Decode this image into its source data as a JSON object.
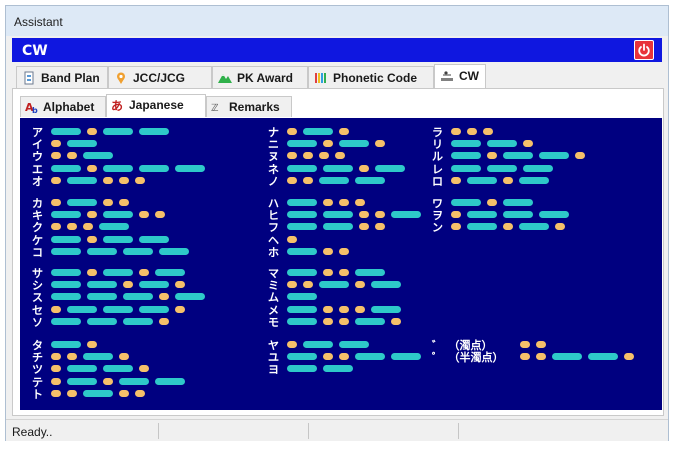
{
  "window": {
    "title": "Assistant"
  },
  "header": {
    "title": "CW"
  },
  "main_tabs": [
    {
      "label": "Band Plan",
      "icon": "document-icon"
    },
    {
      "label": "JCC/JCG",
      "icon": "map-pin-icon"
    },
    {
      "label": "PK Award",
      "icon": "mountain-icon"
    },
    {
      "label": "Phonetic Code",
      "icon": "bars-icon"
    },
    {
      "label": "CW",
      "icon": "key-icon",
      "active": true
    }
  ],
  "sub_tabs": [
    {
      "label": "Alphabet",
      "icon": "alphabet-icon"
    },
    {
      "label": "Japanese",
      "icon": "japanese-icon",
      "active": true
    },
    {
      "label": "Remarks",
      "icon": "remarks-icon"
    }
  ],
  "morse": {
    "colors": {
      "dit": "#f5c06a",
      "dah": "#2ec9c9",
      "background": "#000080"
    },
    "columns": [
      {
        "groups": [
          [
            [
              "ア",
              "-.--"
            ],
            [
              "イ",
              ".-"
            ],
            [
              "ウ",
              "..-"
            ],
            [
              "エ",
              "-.---"
            ],
            [
              "オ",
              ".-..."
            ]
          ],
          [
            [
              "カ",
              ".-.."
            ],
            [
              "キ",
              "-.-.."
            ],
            [
              "ク",
              "...-"
            ],
            [
              "ケ",
              "-.--"
            ],
            [
              "コ",
              "----"
            ]
          ],
          [
            [
              "サ",
              "-.-.-"
            ],
            [
              "シ",
              "--.-."
            ],
            [
              "ス",
              "---.-"
            ],
            [
              "セ",
              ".---."
            ],
            [
              "ソ",
              "---."
            ]
          ],
          [
            [
              "タ",
              "-."
            ],
            [
              "チ",
              "..-."
            ],
            [
              "ツ",
              ".--."
            ],
            [
              "テ",
              ".-.--"
            ],
            [
              "ト",
              "..-.."
            ]
          ]
        ]
      },
      {
        "groups": [
          [
            [
              "ナ",
              ".-."
            ],
            [
              "ニ",
              "-.-."
            ],
            [
              "ヌ",
              "...."
            ],
            [
              "ネ",
              "--.-"
            ],
            [
              "ノ",
              "..--"
            ]
          ],
          [
            [
              "ハ",
              "-..."
            ],
            [
              "ヒ",
              "--..-"
            ],
            [
              "フ",
              "--.."
            ],
            [
              "ヘ",
              "."
            ],
            [
              "ホ",
              "-.."
            ]
          ],
          [
            [
              "マ",
              "-..-"
            ],
            [
              "ミ",
              "..-.-"
            ],
            [
              "ム",
              "-"
            ],
            [
              "メ",
              "-...-"
            ],
            [
              "モ",
              "-..-."
            ]
          ],
          [
            [
              "ヤ",
              ".--"
            ],
            [
              "ユ",
              "-..--"
            ],
            [
              "ヨ",
              "--"
            ]
          ]
        ]
      },
      {
        "groups": [
          [
            [
              "ラ",
              "..."
            ],
            [
              "リ",
              "--."
            ],
            [
              "ル",
              "-.--."
            ],
            [
              "レ",
              "---"
            ],
            [
              "ロ",
              ".-.-"
            ]
          ],
          [
            [
              "ワ",
              "-.-"
            ],
            [
              "ヲ",
              ".---"
            ],
            [
              "ン",
              ".-.-."
            ]
          ],
          [],
          [
            [
              "゛　（濁点）",
              ".."
            ],
            [
              "゜　（半濁点）",
              "..--."
            ]
          ]
        ]
      }
    ]
  },
  "status": {
    "text": "Ready.."
  }
}
